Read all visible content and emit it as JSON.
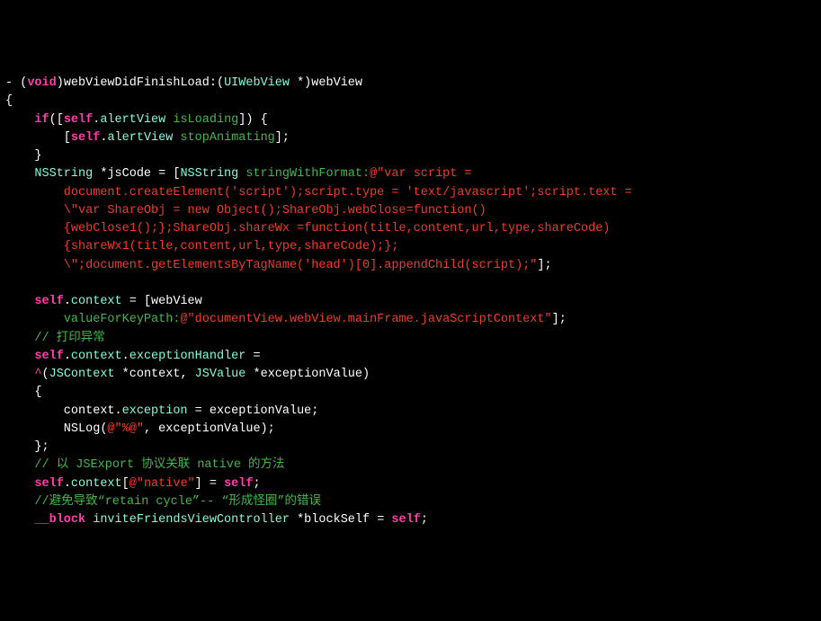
{
  "lines": {
    "l0_a": "- (",
    "l0_b": "void",
    "l0_c": ")webViewDidFinishLoad:(",
    "l0_d": "UIWebView",
    "l0_e": " *)webView",
    "l1": "{",
    "l2_a": "    ",
    "l2_b": "if",
    "l2_c": "([",
    "l2_d": "self",
    "l2_e": ".",
    "l2_f": "alertView",
    "l2_g": " ",
    "l2_h": "isLoading",
    "l2_i": "]) {",
    "l3_a": "        [",
    "l3_b": "self",
    "l3_c": ".",
    "l3_d": "alertView",
    "l3_e": " ",
    "l3_f": "stopAnimating",
    "l3_g": "];",
    "l4": "    }",
    "l5_a": "    ",
    "l5_b": "NSString",
    "l5_c": " *jsCode = [",
    "l5_d": "NSString",
    "l5_e": " ",
    "l5_f": "stringWithFormat:",
    "l5_g": "@\"var script =",
    "l5b": "        document.createElement('script');script.type = 'text/javascript';script.text =",
    "l5c": "        \\\"var ShareObj = new Object();ShareObj.webClose=function()",
    "l5d": "        {webClose1();};ShareObj.shareWx =function(title,content,url,type,shareCode)",
    "l5e": "        {shareWx1(title,content,url,type,shareCode);};",
    "l5f_a": "        \\\";document.getElementsByTagName('head')[0].appendChild(script);\"",
    "l5f_b": "];",
    "l6": "",
    "l7_a": "    ",
    "l7_b": "self",
    "l7_c": ".",
    "l7_d": "context",
    "l7_e": " = [webView",
    "l8_a": "        ",
    "l8_b": "valueForKeyPath:",
    "l8_c": "@\"documentView.webView.mainFrame.javaScriptContext\"",
    "l8_d": "];",
    "l9_a": "    ",
    "l9_b": "// 打印异常",
    "l10_a": "    ",
    "l10_b": "self",
    "l10_c": ".",
    "l10_d": "context",
    "l10_e": ".",
    "l10_f": "exceptionHandler",
    "l10_g": " =",
    "l11_a": "    ",
    "l11_b": "^",
    "l11_c": "(",
    "l11_d": "JSContext",
    "l11_e": " *context, ",
    "l11_f": "JSValue",
    "l11_g": " *exceptionValue)",
    "l12": "    {",
    "l13_a": "        context.",
    "l13_b": "exception",
    "l13_c": " = exceptionValue;",
    "l14_a": "        NSLog(",
    "l14_b": "@\"%@\"",
    "l14_c": ", exceptionValue);",
    "l15": "    };",
    "l16_a": "    ",
    "l16_b": "// 以 JSExport 协议关联 native 的方法",
    "l17_a": "    ",
    "l17_b": "self",
    "l17_c": ".",
    "l17_d": "context",
    "l17_e": "[",
    "l17_f": "@\"native\"",
    "l17_g": "] = ",
    "l17_h": "self",
    "l17_i": ";",
    "l18_a": "    ",
    "l18_b": "//避免导致“retain cycle”-- “形成怪圈”的错误",
    "l19_a": "    ",
    "l19_b": "__block",
    "l19_c": " ",
    "l19_d": "inviteFriendsViewController",
    "l19_e": " *blockSelf = ",
    "l19_f": "self",
    "l19_g": ";"
  }
}
